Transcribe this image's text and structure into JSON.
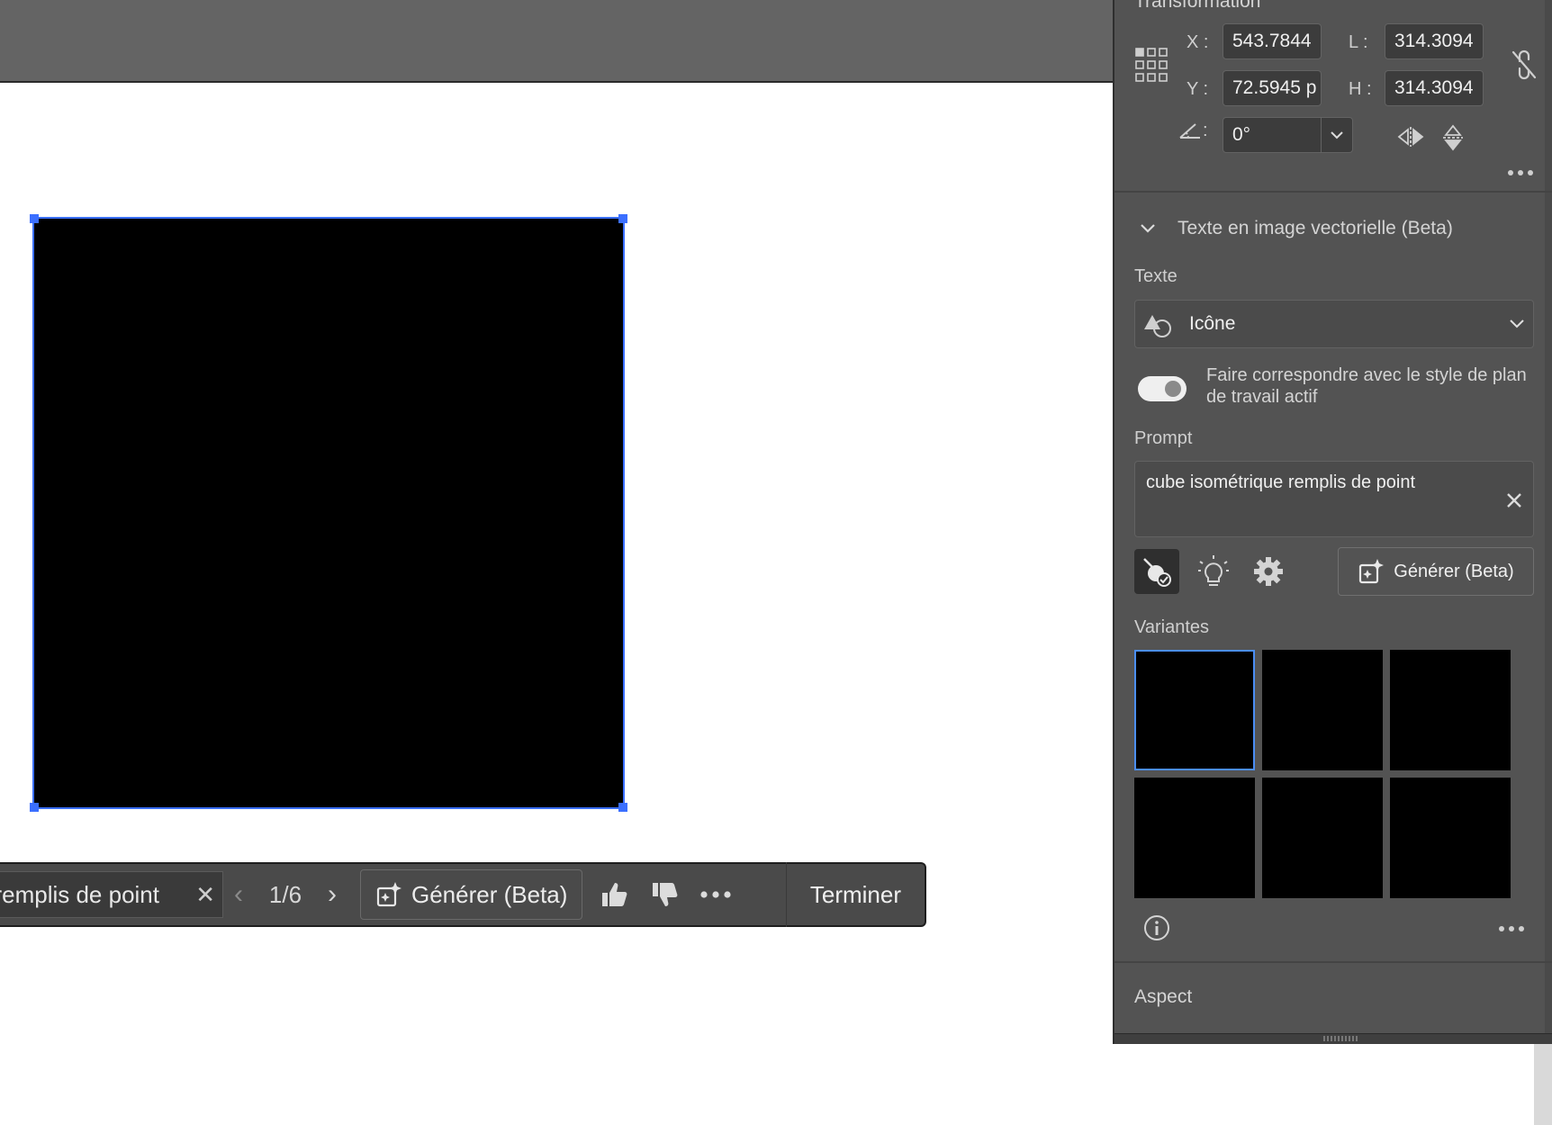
{
  "transform": {
    "title": "Transformation",
    "x_label": "X :",
    "x_value": "543.7844",
    "y_label": "Y :",
    "y_value": "72.5945 p",
    "w_label": "L :",
    "w_value": "314.3094",
    "h_label": "H :",
    "h_value": "314.3094",
    "angle_label": ":",
    "angle_value": "0°"
  },
  "text_to_vector": {
    "section_title": "Texte en image vectorielle (Beta)",
    "type_label": "Texte",
    "type_value": "Icône",
    "match_style_label": "Faire correspondre avec le style de plan de travail actif",
    "prompt_label": "Prompt",
    "prompt_value": "cube isométrique remplis de point",
    "generate_label": "Générer (Beta)",
    "variants_label": "Variantes",
    "variant_count": 6
  },
  "aspect": {
    "title": "Aspect"
  },
  "taskbar": {
    "prompt_value": "cube isométrique remplis de point",
    "counter": "1/6",
    "generate_label": "Générer (Beta)",
    "done_label": "Terminer"
  },
  "colors": {
    "selection": "#3b6fff",
    "panel": "#535353",
    "accent": "#4b8ef5"
  }
}
